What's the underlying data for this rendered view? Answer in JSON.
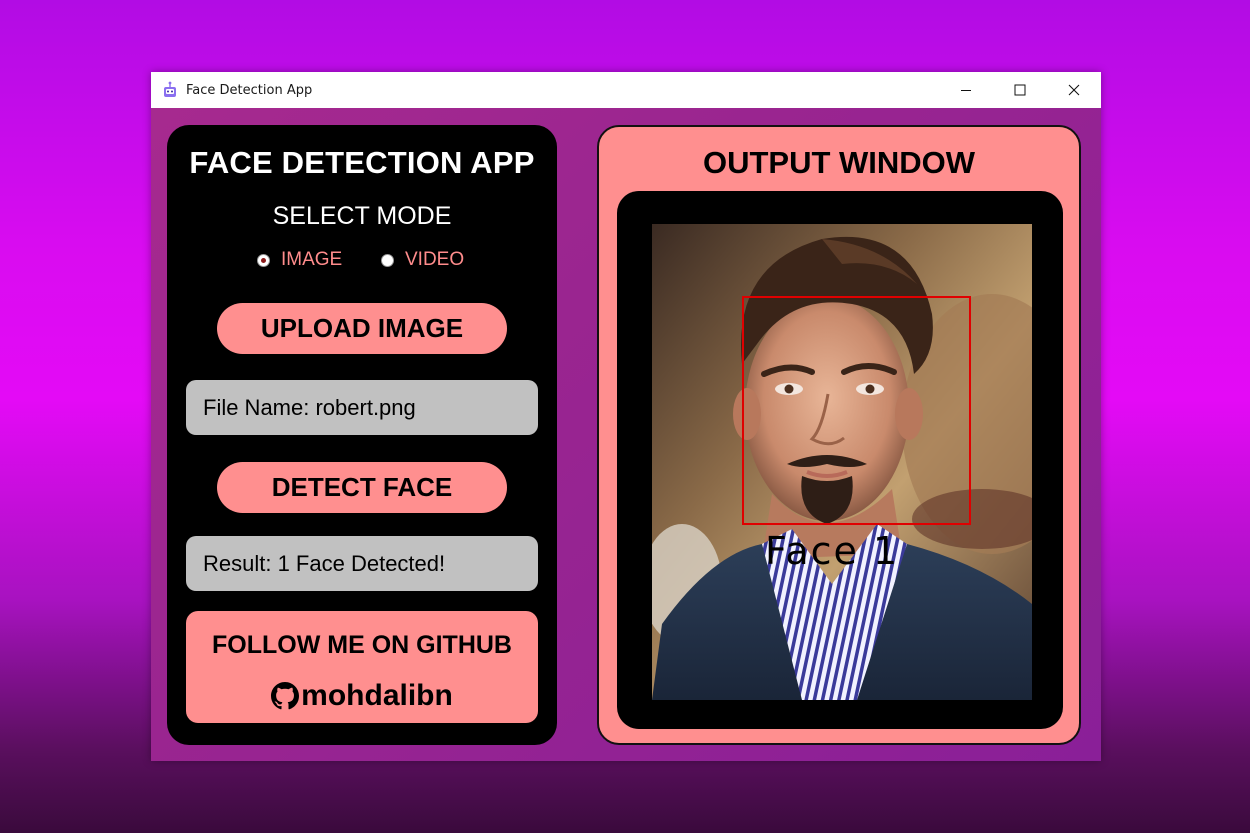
{
  "window": {
    "title": "Face Detection App",
    "icon": "robot-icon",
    "controls": [
      "minimize-icon",
      "maximize-icon",
      "close-icon"
    ]
  },
  "left_panel": {
    "heading": "FACE DETECTION APP",
    "mode_heading": "SELECT MODE",
    "modes": [
      {
        "label": "IMAGE",
        "selected": true
      },
      {
        "label": "VIDEO",
        "selected": false
      }
    ],
    "upload_button": "UPLOAD IMAGE",
    "file_name": "File Name: robert.png",
    "detect_button": "DETECT FACE",
    "result": "Result: 1 Face Detected!",
    "github": {
      "title": "FOLLOW ME ON GITHUB",
      "username": "mohdalibn",
      "icon": "github-icon"
    }
  },
  "output": {
    "heading": "OUTPUT WINDOW",
    "detection_label": "Face 1"
  },
  "colors": {
    "accent": "#ff8f8f",
    "panel_bg": "#000000",
    "info_bg": "#c1c1c1",
    "detection_box": "#e00000",
    "radio_text": "#ff8c8c"
  }
}
